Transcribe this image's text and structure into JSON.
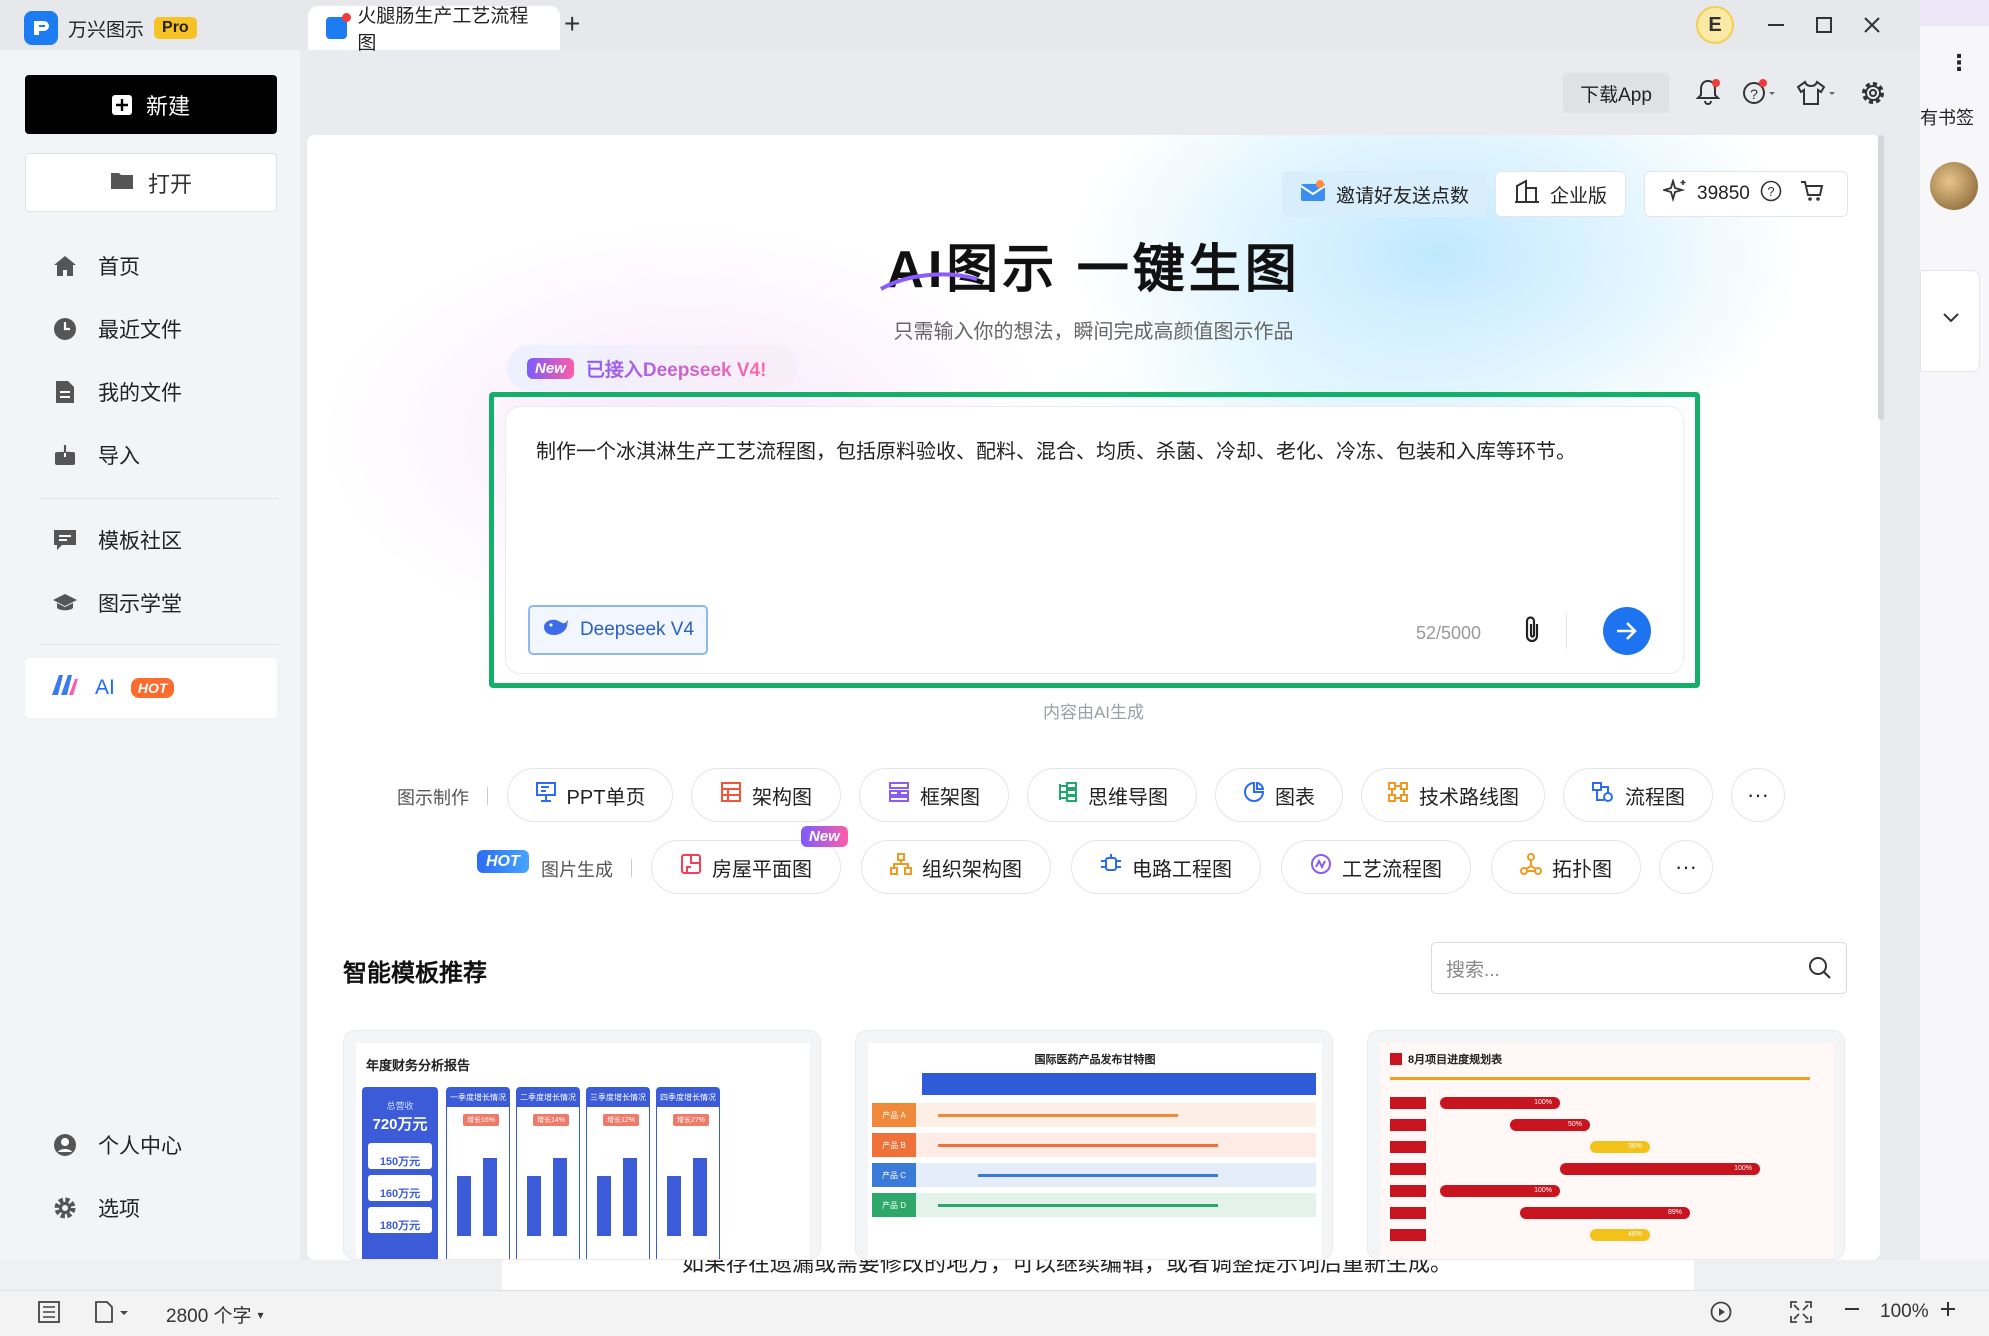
{
  "titlebar": {
    "app_name": "万兴图示",
    "pro_label": "Pro",
    "doc_tab": "火腿肠生产工艺流程图",
    "add_tab": "+",
    "avatar_letter": "E"
  },
  "sidebar": {
    "new_label": "新建",
    "open_label": "打开",
    "items": [
      {
        "label": "首页"
      },
      {
        "label": "最近文件"
      },
      {
        "label": "我的文件"
      },
      {
        "label": "导入"
      },
      {
        "label": "模板社区"
      },
      {
        "label": "图示学堂"
      }
    ],
    "ai_label": "AI",
    "ai_hot": "HOT",
    "profile_label": "个人中心",
    "options_label": "选项"
  },
  "toolbar": {
    "download_app": "下载App"
  },
  "hero": {
    "invite_label": "邀请好友送点数",
    "enterprise_label": "企业版",
    "points": "39850",
    "title": "AI图示 一键生图",
    "subtitle": "只需输入你的想法，瞬间完成高颜值图示作品",
    "new_badge": "New",
    "deepseek_tag": "已接入Deepseek V4!",
    "prompt": "制作一个冰淇淋生产工艺流程图，包括原料验收、配料、混合、均质、杀菌、冷却、老化、冷冻、包装和入库等环节。",
    "model_label": "Deepseek V4",
    "counter": "52/5000",
    "ai_note": "内容由AI生成"
  },
  "categories": {
    "row1_label": "图示制作",
    "row1": [
      {
        "label": "PPT单页",
        "icon": "presentation-icon"
      },
      {
        "label": "架构图",
        "icon": "architecture-icon"
      },
      {
        "label": "框架图",
        "icon": "framework-icon"
      },
      {
        "label": "思维导图",
        "icon": "mindmap-icon"
      },
      {
        "label": "图表",
        "icon": "chart-icon"
      },
      {
        "label": "技术路线图",
        "icon": "roadmap-icon"
      },
      {
        "label": "流程图",
        "icon": "flowchart-icon"
      }
    ],
    "row2_hot": "HOT",
    "row2_label": "图片生成",
    "row2_new": "New",
    "row2": [
      {
        "label": "房屋平面图",
        "icon": "floorplan-icon"
      },
      {
        "label": "组织架构图",
        "icon": "orgchart-icon"
      },
      {
        "label": "电路工程图",
        "icon": "circuit-icon"
      },
      {
        "label": "工艺流程图",
        "icon": "process-icon"
      },
      {
        "label": "拓扑图",
        "icon": "topology-icon"
      }
    ],
    "more": "···"
  },
  "templates": {
    "section_title": "智能模板推荐",
    "search_placeholder": "搜索...",
    "cards": [
      {
        "title": "年度财务分析报告",
        "total_label": "总营收",
        "total": "720万元",
        "q_values": [
          "150万元",
          "160万元",
          "180万元"
        ],
        "cols": [
          "一季度增长情况",
          "二季度增长情况",
          "三季度增长情况",
          "四季度增长情况"
        ],
        "growth": [
          "增长16%",
          "增长14%",
          "增长12%",
          "增长27%"
        ]
      },
      {
        "title": "国际医药产品发布甘特图",
        "rows": [
          "产品 A",
          "产品 B",
          "产品 C",
          "产品 D"
        ]
      },
      {
        "title": "8月项目进度规划表",
        "bar_labels": [
          "100%",
          "50%",
          "36%",
          "100%",
          "100%",
          "89%",
          "46%"
        ]
      }
    ]
  },
  "right_strip": {
    "bookmarks": "有书签"
  },
  "document": {
    "text": "如果存在遗漏或需要修改的地方，可以继续编辑，或者调整提示词后重新生成。"
  },
  "statusbar": {
    "word_count": "2800 个字",
    "zoom": "100%"
  },
  "colors": {
    "accent": "#1e74f0",
    "highlight_border": "#14b06a",
    "hot": "#ff6b2c",
    "pro": "#f7c324"
  }
}
